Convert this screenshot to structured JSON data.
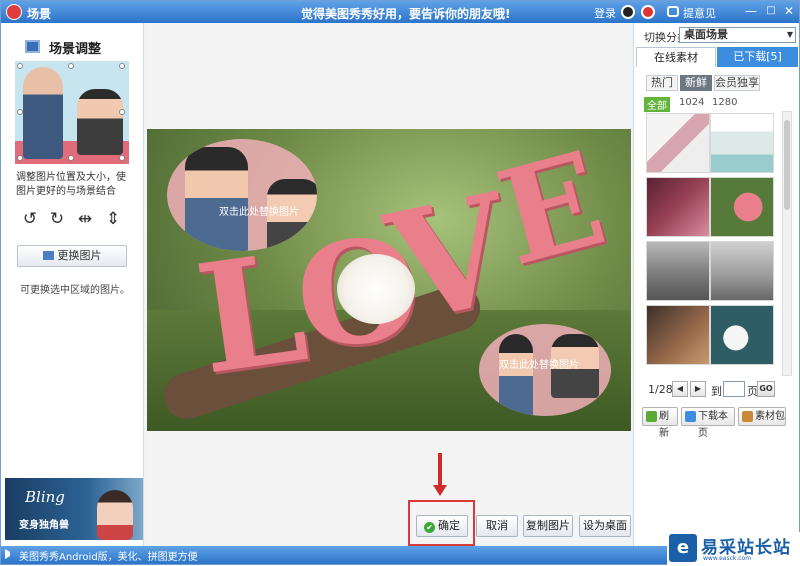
{
  "titlebar": {
    "title": "场景",
    "slogan": "觉得美图秀秀好用，要告诉你的朋友哦!",
    "login": "登录",
    "feedback": "提意见",
    "minimize": "—",
    "maximize": "□",
    "close": "✕"
  },
  "left": {
    "title": "场景调整",
    "hint": "调整图片位置及大小，使图片更好的与场景结合",
    "tools": [
      "↺",
      "↻",
      "⇹",
      "⇕"
    ],
    "replace_label": "更换图片",
    "handnote": "可更换选中区域的图片。",
    "ad": {
      "brand": "Bling",
      "tagline": "变身独角兽"
    }
  },
  "canvas": {
    "bubble_text_1": "双击此处替换图片",
    "bubble_text_2": "双击此处替换图片",
    "letters": [
      "L",
      "O",
      "V",
      "E"
    ]
  },
  "actions": {
    "confirm": "确定",
    "cancel": "取消",
    "copy": "复制图片",
    "set_desktop": "设为桌面"
  },
  "right": {
    "category_label": "切换分类",
    "category_value": "桌面场景",
    "tabs": {
      "online": "在线素材",
      "downloaded": "已下载[5]"
    },
    "filters": [
      "热门",
      "新鲜",
      "会员独享"
    ],
    "active_filter": "新鲜",
    "sizes": [
      "全部",
      "1024",
      "1280"
    ],
    "page_info": "1/28",
    "prev": "◀",
    "next": "▶",
    "to": "到",
    "page_unit": "页",
    "go": "GO",
    "refresh": "刷新",
    "download_page": "下载本页",
    "material_pack": "素材包"
  },
  "statusbar": {
    "text": "美图秀秀Android版，美化、拼图更方便"
  },
  "watermark": {
    "logo": "e",
    "name": "易采站长站",
    "url": "www.easck.com"
  },
  "colors": {
    "accent": "#3c8ce0",
    "highlight": "#d93b3b",
    "love_pink": "#e97f8a"
  }
}
